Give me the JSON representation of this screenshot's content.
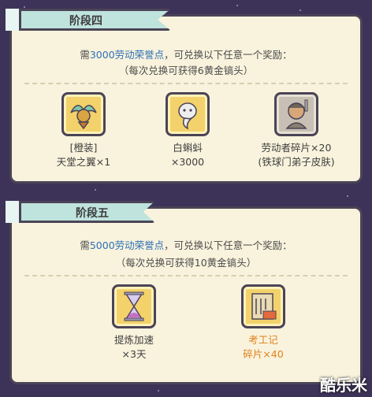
{
  "stage4": {
    "title": "阶段四",
    "req_pre": "需",
    "req_highlight": "3000劳动荣誉点",
    "req_post": "，可兑换以下任意一个奖励：",
    "sub": "（每次兑换可获得6黄金镐头）",
    "rewards": [
      {
        "icon": "winged-helmet-icon",
        "line1": "[橙装]",
        "line2": "天堂之翼×1"
      },
      {
        "icon": "white-tadpole-icon",
        "line1": "白蝌蚪",
        "line2": "×3000"
      },
      {
        "icon": "worker-portrait-icon",
        "line1": "劳动者碎片×20",
        "line2": "(铁球门弟子皮肤)"
      }
    ]
  },
  "stage5": {
    "title": "阶段五",
    "req_pre": "需",
    "req_highlight": "5000劳动荣誉点",
    "req_post": "，可兑换以下任意一个奖励：",
    "sub": "（每次兑换可获得10黄金镐头）",
    "rewards": [
      {
        "icon": "hourglass-icon",
        "line1": "提炼加速",
        "line2": "×3天"
      },
      {
        "icon": "scroll-book-icon",
        "line1": "考工记",
        "line2": "碎片×40"
      }
    ]
  },
  "colors": {
    "highlight": "#2d6fb6",
    "orange": "#e0821c",
    "panel": "#f9f3dd",
    "banner": "#bfe3dd"
  },
  "watermark": "酷乐米"
}
